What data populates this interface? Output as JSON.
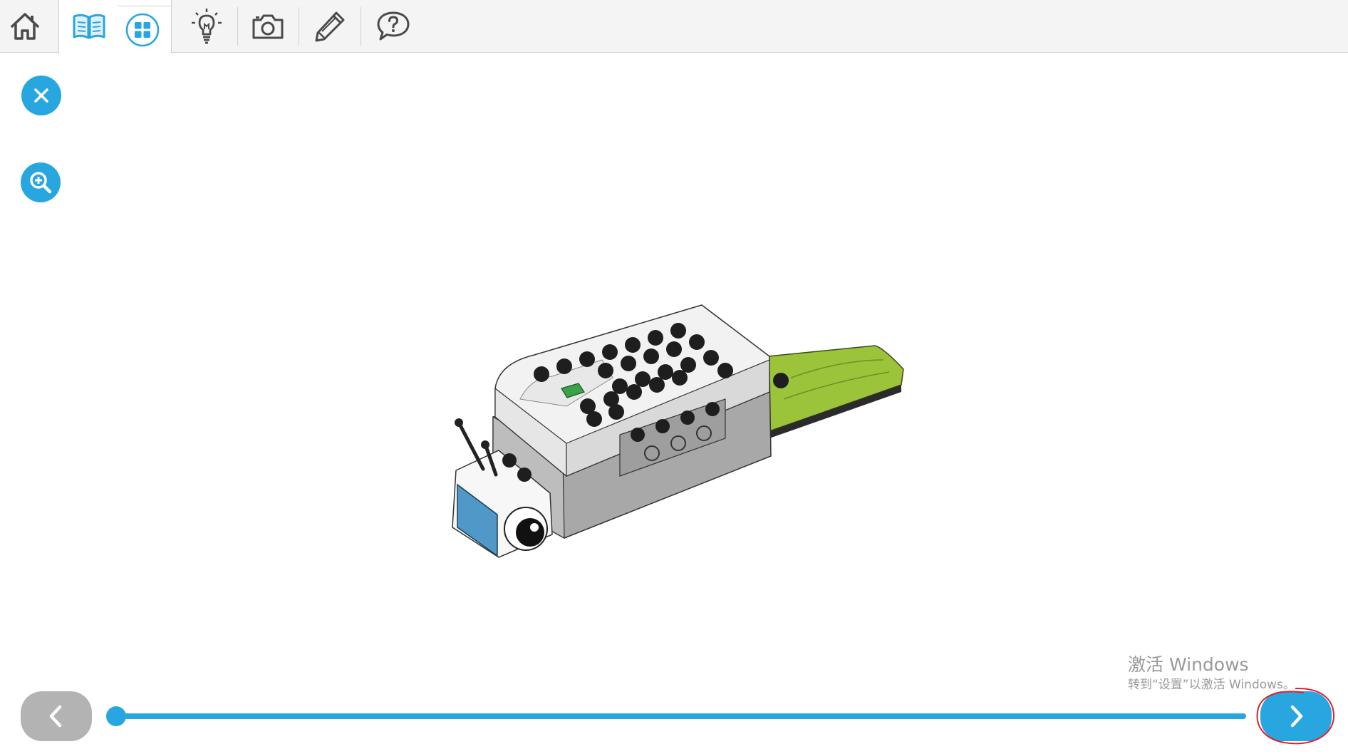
{
  "toolbar": {
    "items": [
      {
        "name": "home",
        "icon": "home-icon"
      },
      {
        "name": "instructions",
        "icon": "open-book-icon"
      },
      {
        "name": "grid",
        "icon": "grid-icon"
      },
      {
        "name": "ideas",
        "icon": "lightbulb-icon"
      },
      {
        "name": "camera",
        "icon": "camera-icon"
      },
      {
        "name": "edit",
        "icon": "pencil-icon"
      },
      {
        "name": "help",
        "icon": "question-bubble-icon"
      }
    ],
    "active": "instructions"
  },
  "side_controls": {
    "close_icon": "close-icon",
    "zoom_icon": "zoom-in-icon"
  },
  "model": {
    "description_icon": "lego-snail-model",
    "colors": {
      "body": "#ffffff",
      "base": "#a8a8a8",
      "leaf": "#9cc43a",
      "screen": "#4f98c8",
      "button": "#3aa24a"
    }
  },
  "navigation": {
    "prev_icon": "chevron-left-icon",
    "next_icon": "chevron-right-icon",
    "progress": 0.0
  },
  "watermark": {
    "line1": "激活 Windows",
    "line2": "转到“设置”以激活 Windows。"
  },
  "colors": {
    "accent": "#27a6e0",
    "disabled": "#b3b3b3",
    "annotation": "#e0202a"
  }
}
